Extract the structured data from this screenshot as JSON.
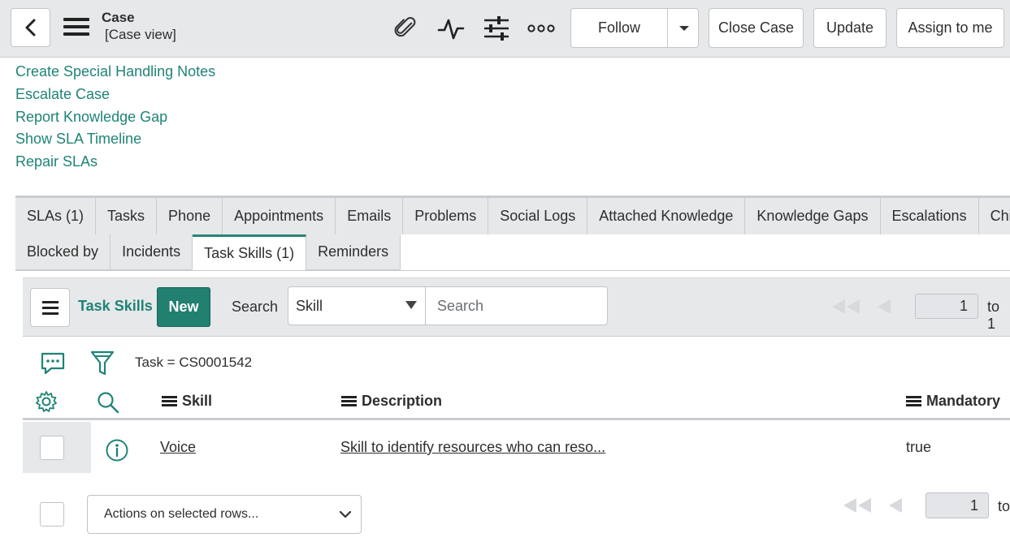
{
  "header": {
    "title": "Case",
    "subtitle": "[Case view]",
    "icons": [
      "back-arrow-icon",
      "hamburger-menu-icon",
      "paperclip-icon",
      "activity-pulse-icon",
      "sliders-icon",
      "more-dots-icon"
    ],
    "follow_label": "Follow",
    "close_case_label": "Close Case",
    "update_label": "Update",
    "assign_label": "Assign to me"
  },
  "related_links": [
    "Create Special Handling Notes",
    "Escalate Case",
    "Report Knowledge Gap",
    "Show SLA Timeline",
    "Repair SLAs"
  ],
  "tabs_row1": [
    "SLAs (1)",
    "Tasks",
    "Phone",
    "Appointments",
    "Emails",
    "Problems",
    "Social Logs",
    "Attached Knowledge",
    "Knowledge Gaps",
    "Escalations",
    "Chi"
  ],
  "tabs_row2": [
    "Blocked by",
    "Incidents",
    "Task Skills (1)",
    "Reminders"
  ],
  "active_tab": "Task Skills (1)",
  "list": {
    "title": "Task Skills",
    "new_label": "New",
    "search_label": "Search",
    "search_field": "Skill",
    "search_placeholder": "Search",
    "page_current": "1",
    "to_label": "to 1",
    "breadcrumb": "Task = CS0001542",
    "columns": [
      "Skill",
      "Description",
      "Mandatory"
    ],
    "rows": [
      {
        "skill": "Voice",
        "description": "Skill to identify resources who can reso...",
        "mandatory": "true"
      }
    ],
    "actions_label": "Actions on selected rows...",
    "footer_page_current": "1",
    "footer_to_label": "to"
  },
  "colors": {
    "link": "#1f8476",
    "primary_button": "#218070",
    "header_bg": "#e6e8ea"
  }
}
